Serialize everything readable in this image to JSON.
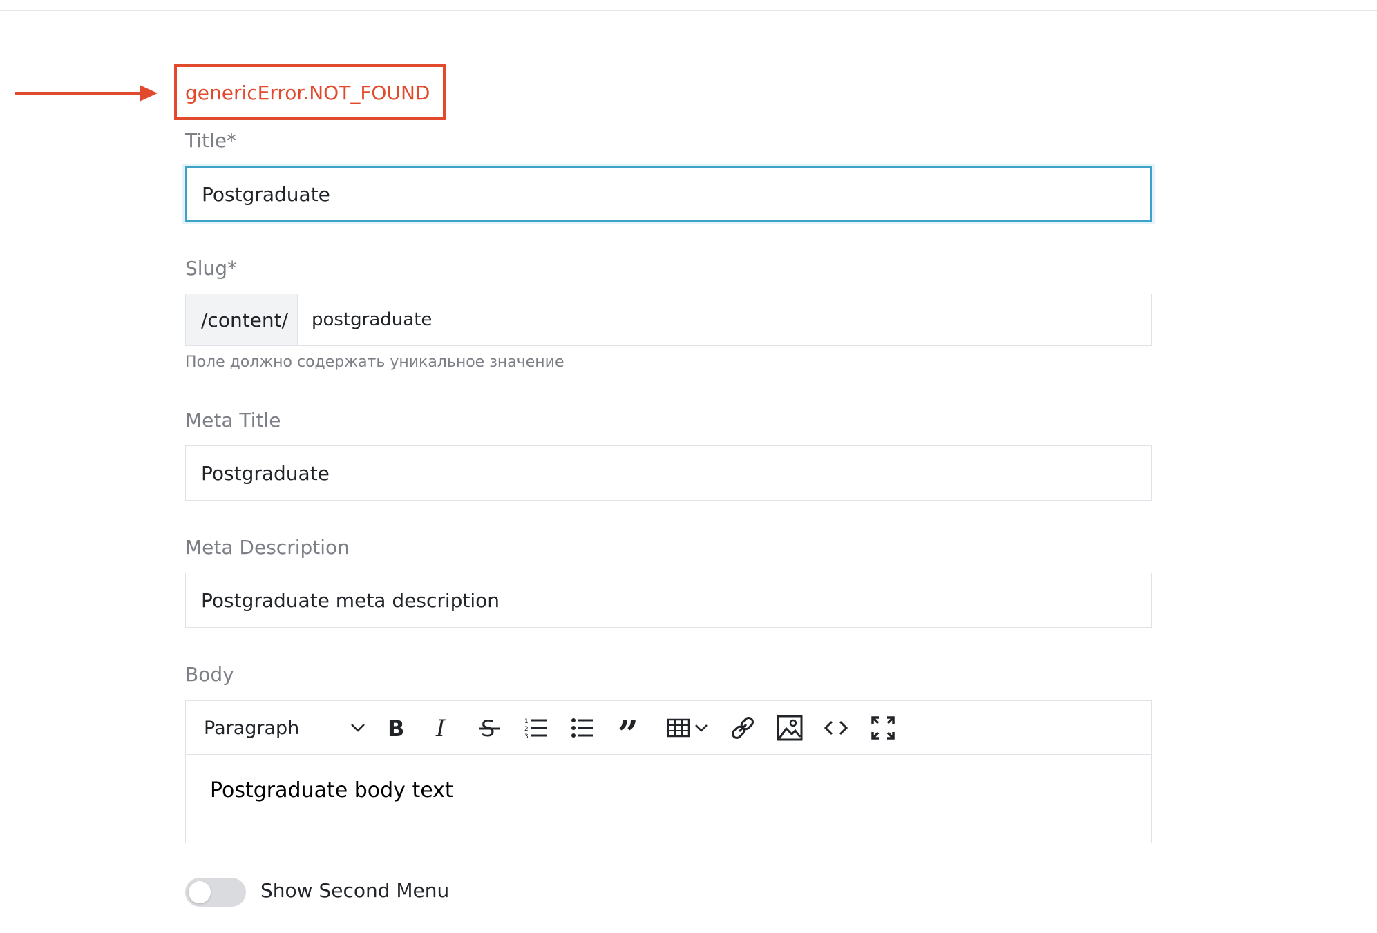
{
  "error": {
    "message": "genericError.NOT_FOUND",
    "color": "#e24a2e"
  },
  "fields": {
    "title": {
      "label": "Title*",
      "value": "Postgraduate"
    },
    "slug": {
      "label": "Slug*",
      "prefix": "/content/",
      "value": "postgraduate",
      "hint": "Поле должно содержать уникальное значение"
    },
    "meta_title": {
      "label": "Meta Title",
      "value": "Postgraduate"
    },
    "meta_description": {
      "label": "Meta Description",
      "value": "Postgraduate meta description"
    },
    "body": {
      "label": "Body",
      "block_type": "Paragraph",
      "content": "Postgraduate body text",
      "toolbar_icons": [
        "bold-icon",
        "italic-icon",
        "strikethrough-icon",
        "numbered-list-icon",
        "bulleted-list-icon",
        "blockquote-icon",
        "table-icon",
        "link-icon",
        "image-icon",
        "code-icon",
        "fullscreen-icon"
      ]
    }
  },
  "show_second_menu": {
    "label": "Show Second Menu",
    "enabled": false
  },
  "colors": {
    "focus_border": "#3aa3c7",
    "label": "#7c7f86",
    "border": "#dfe2e6"
  }
}
